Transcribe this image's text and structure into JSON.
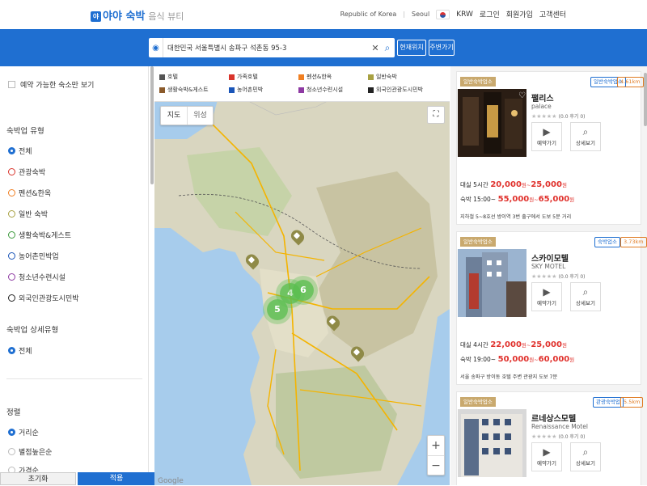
{
  "header": {
    "logo_badge": "야",
    "logo_brand": "야야",
    "logo_title": "숙박",
    "logo_sub": "음식 뷰티",
    "country": "Republic of Korea",
    "city": "Seoul",
    "currency": "KRW",
    "nav_login": "로그인",
    "nav_join": "회원가입",
    "nav_support": "고객센터"
  },
  "search": {
    "value": "대한민국 서울특별시 송파구 석촌동 95-3",
    "btn_current": "현재위치",
    "btn_near": "주변가기"
  },
  "filters": {
    "only_available": "예약 가능한 숙소만 보기",
    "type_title": "숙박업 유형",
    "types": [
      "전체",
      "관광숙박",
      "펜션&한옥",
      "일반 숙박",
      "생활숙박&게스트",
      "농어촌민박업",
      "청소년수련시설",
      "외국인관광도시민박"
    ],
    "detail_title": "숙박업 상세유형",
    "detail_options": [
      "전체"
    ],
    "sort_title": "정렬",
    "sort_options": [
      "거리순",
      "별점높은순",
      "가격순"
    ],
    "btn_reset": "초기화",
    "btn_apply": "적용"
  },
  "map": {
    "legend": [
      {
        "label": "호텔",
        "color": "#555555"
      },
      {
        "label": "가족호텔",
        "color": "#d9342b"
      },
      {
        "label": "펜션&한옥",
        "color": "#f07f22"
      },
      {
        "label": "일반숙박",
        "color": "#a8a142"
      },
      {
        "label": "생활숙박&게스트",
        "color": "#8b5a2b"
      },
      {
        "label": "농어촌민박",
        "color": "#1a55b8"
      },
      {
        "label": "청소년수련시설",
        "color": "#8e3aa3"
      },
      {
        "label": "외국인관광도시민박",
        "color": "#222222"
      }
    ],
    "type_map": "지도",
    "type_satellite": "위성",
    "clusters": [
      "4",
      "6",
      "5"
    ],
    "attribution": "Google"
  },
  "listings": [
    {
      "category": "일반숙박업소",
      "tag_a": "일반숙박업소",
      "tag_distance": "4.61km",
      "name": "팰리스",
      "name_en": "palace",
      "rating_text": "(0.0 후기 0)",
      "btn_reserve": "예약가기",
      "btn_detail": "상세보기",
      "stay_label": "숙박 15:00~",
      "stay_from": "55,000",
      "stay_to": "65,000",
      "rent_label": "대실 5시간",
      "rent_from": "20,000",
      "rent_to": "25,000",
      "currency": "원",
      "note": "지하철 5~8호선 방이역 3번 출구에서 도보 5분 거리"
    },
    {
      "category": "일반숙박업소",
      "tag_a": "숙박업소",
      "tag_distance": "3.73km",
      "name": "스카이모텔",
      "name_en": "SKY MOTEL",
      "rating_text": "(0.0 후기 0)",
      "btn_reserve": "예약가기",
      "btn_detail": "상세보기",
      "stay_label": "숙박 19:00~",
      "stay_from": "50,000",
      "stay_to": "60,000",
      "rent_label": "대실 4시간",
      "rent_from": "22,000",
      "rent_to": "25,000",
      "currency": "원",
      "note": "서울 송파구 방이동 호텔 주변 관광지 도보 7분"
    },
    {
      "category": "일반숙박업소",
      "tag_a": "관광숙박업",
      "tag_distance": "5.5km",
      "name": "르네상스모텔",
      "name_en": "Renaissance Motel",
      "rating_text": "(0.0 후기 0)",
      "btn_reserve": "예약가기",
      "btn_detail": "상세보기"
    }
  ]
}
